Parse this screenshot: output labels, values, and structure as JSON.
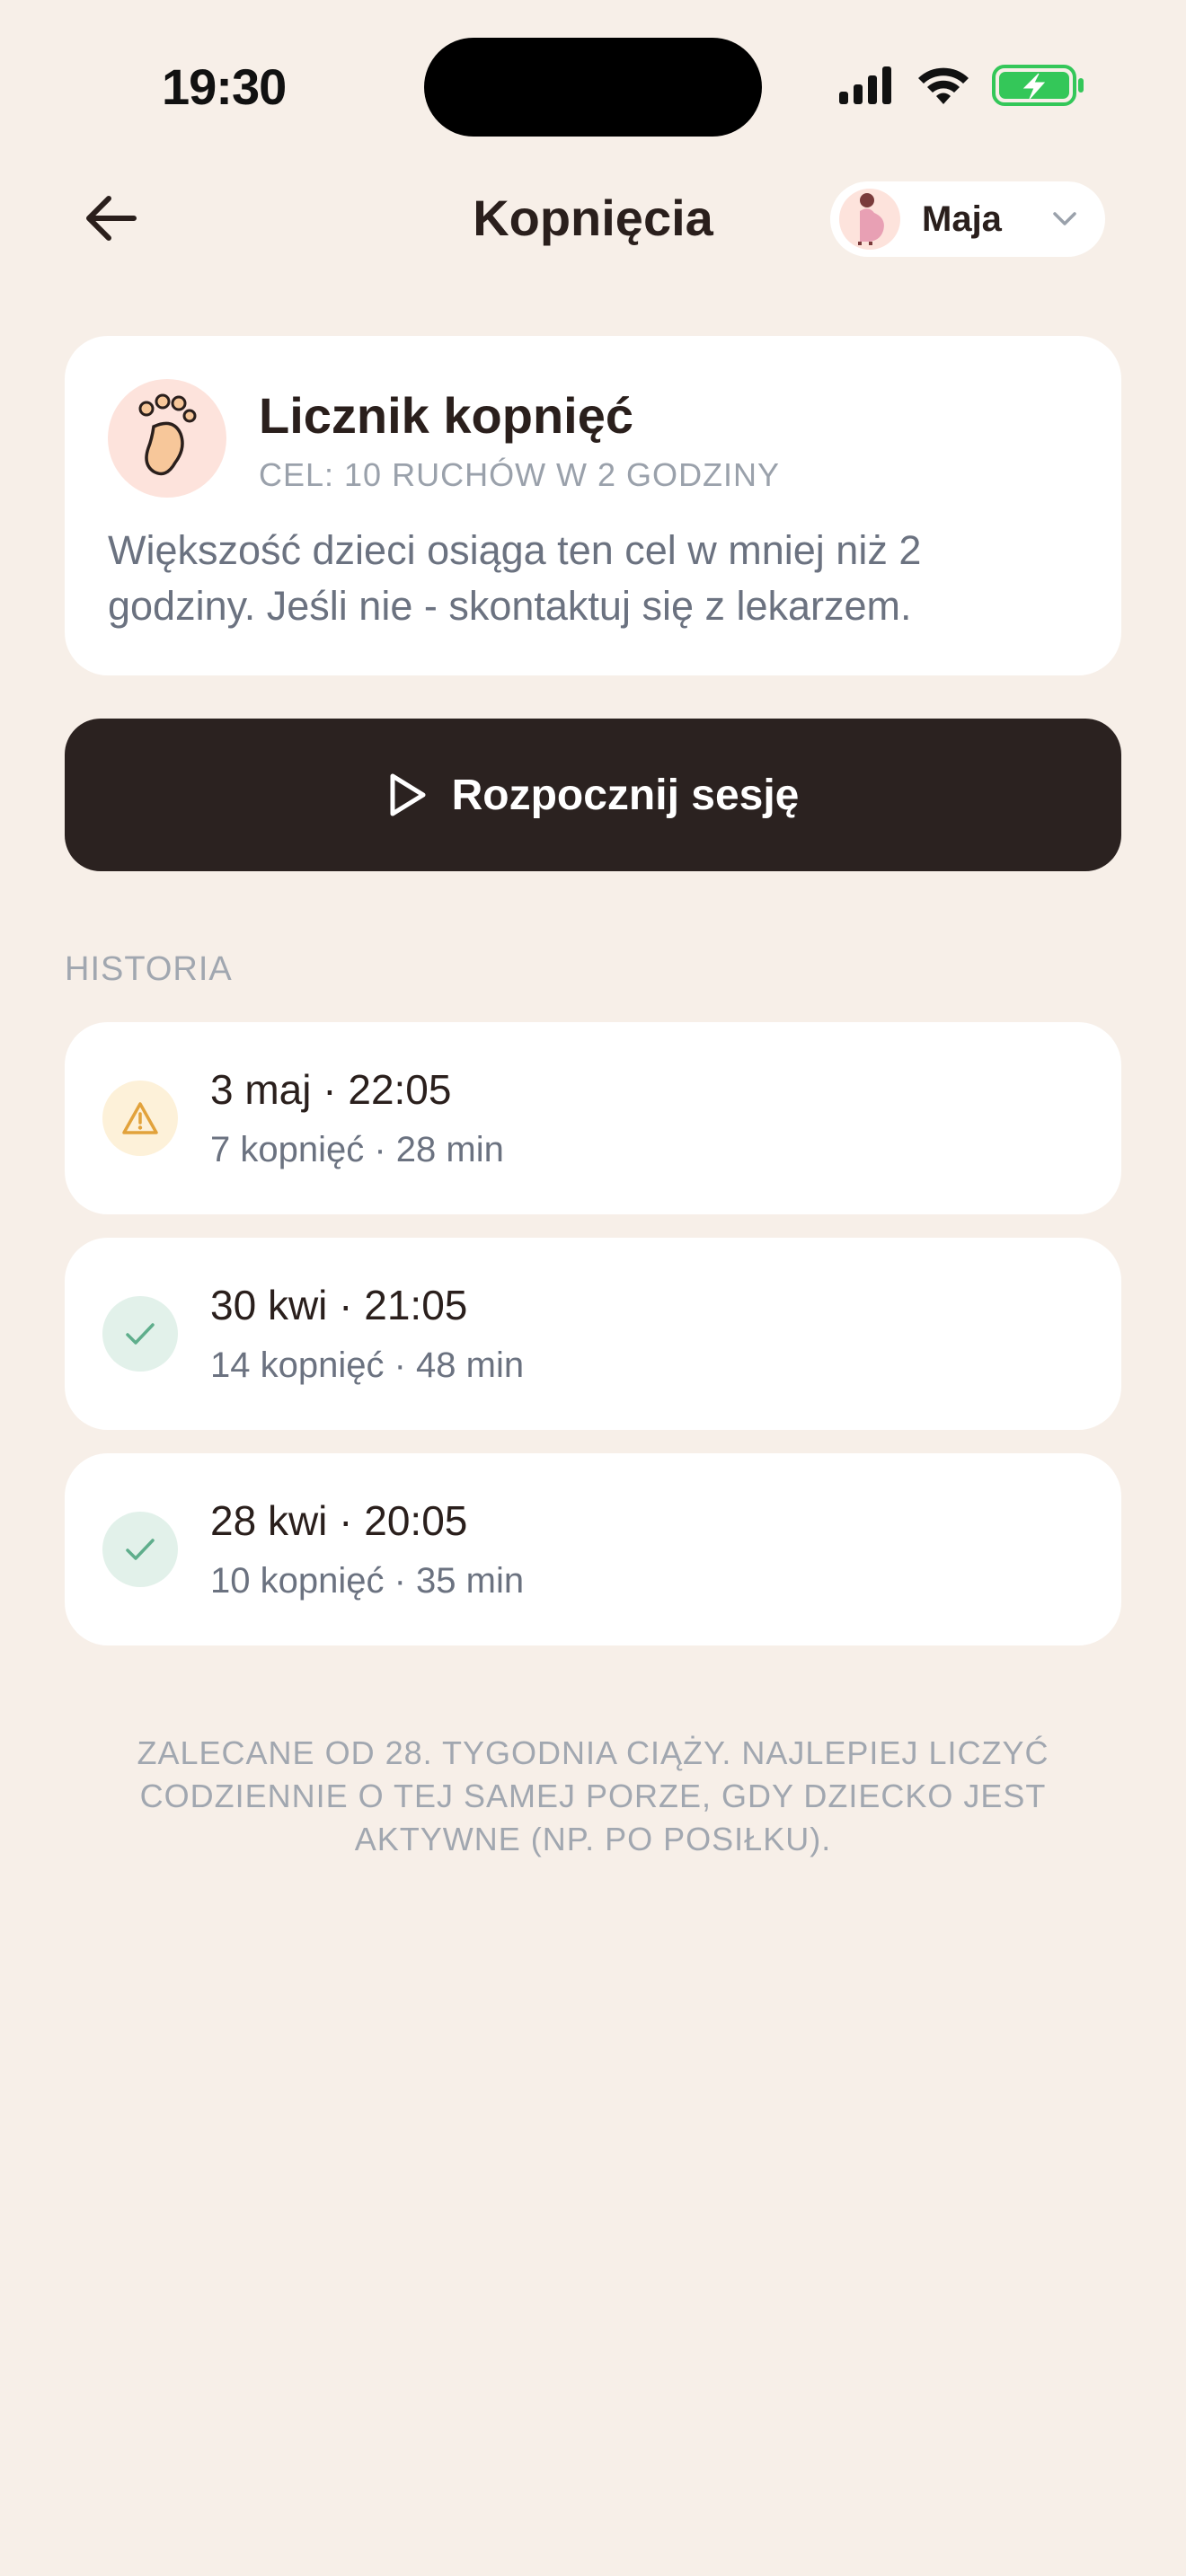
{
  "status_bar": {
    "time": "19:30"
  },
  "header": {
    "title": "Kopnięcia",
    "profile_name": "Maja"
  },
  "info_card": {
    "title": "Licznik kopnięć",
    "subtitle": "CEL: 10 RUCHÓW W 2 GODZINY",
    "description": "Większość dzieci osiąga ten cel w mniej niż 2 godziny. Jeśli nie - skontaktuj się z lekarzem."
  },
  "start_button": {
    "label": "Rozpocznij sesję"
  },
  "history": {
    "section_label": "HISTORIA",
    "items": [
      {
        "title": "3 maj · 22:05",
        "detail": "7 kopnięć · 28 min",
        "status": "warning"
      },
      {
        "title": "30 kwi · 21:05",
        "detail": "14 kopnięć · 48 min",
        "status": "ok"
      },
      {
        "title": "28 kwi · 20:05",
        "detail": "10 kopnięć · 35 min",
        "status": "ok"
      }
    ]
  },
  "footnote": "ZALECANE OD 28. TYGODNIA CIĄŻY. NAJLEPIEJ LICZYĆ CODZIENNIE O TEJ SAMEJ PORZE, GDY DZIECKO JEST AKTYWNE (NP. PO POSIŁKU).",
  "colors": {
    "background": "#f7efe8",
    "card": "#ffffff",
    "primary_button": "#2b2220",
    "warning": "#e2a23b",
    "ok": "#5fae8c",
    "battery": "#34c759"
  }
}
